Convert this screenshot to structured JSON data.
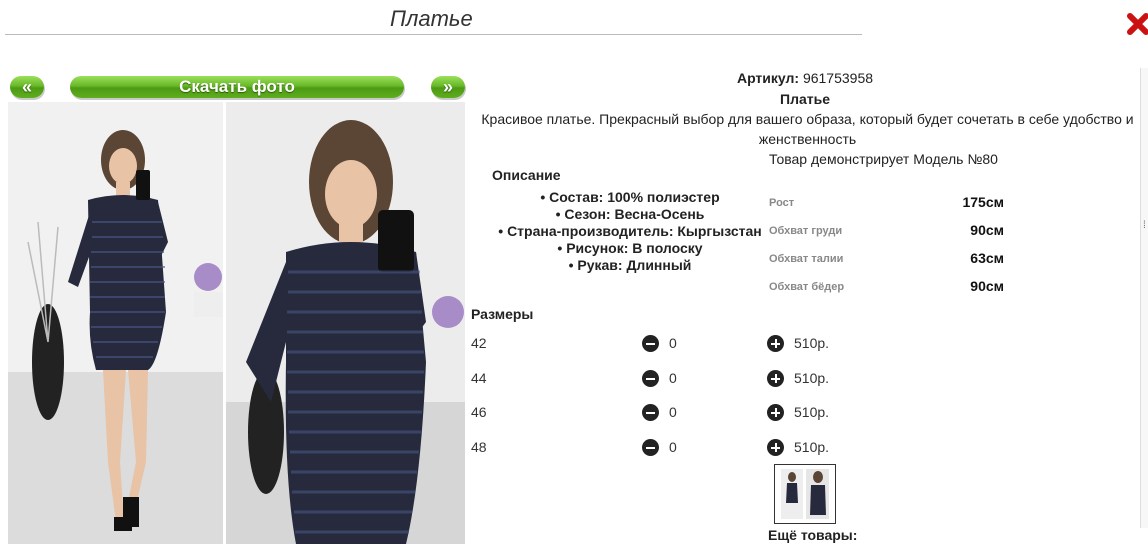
{
  "header": {
    "title": "Платье"
  },
  "gallery": {
    "prev_label": "«",
    "download_label": "Скачать фото",
    "next_label": "»"
  },
  "product": {
    "article_label": "Артикул:",
    "article_value": "961753958",
    "name": "Платье",
    "description": "Красивое платье. Прекрасный выбор для вашего образа, который будет сочетать в себе удобство и женственность",
    "model_text": "Товар демонстрирует Модель №80",
    "description_heading": "Описание",
    "specs": [
      "Состав: 100% полиэстер",
      "Сезон: Весна-Осень",
      "Страна-производитель: Кыргызстан",
      "Рисунок: В полоску",
      "Рукав: Длинный"
    ],
    "measurements": [
      {
        "label": "Рост",
        "value": "175см"
      },
      {
        "label": "Обхват груди",
        "value": "90см"
      },
      {
        "label": "Обхват талии",
        "value": "63см"
      },
      {
        "label": "Обхват бёдер",
        "value": "90см"
      }
    ]
  },
  "sizes": {
    "heading": "Размеры",
    "rows": [
      {
        "size": "42",
        "qty": "0",
        "price": "510р."
      },
      {
        "size": "44",
        "qty": "0",
        "price": "510р."
      },
      {
        "size": "46",
        "qty": "0",
        "price": "510р."
      },
      {
        "size": "48",
        "qty": "0",
        "price": "510р."
      }
    ]
  },
  "more_products_label": "Ещё товары:",
  "colors": {
    "accent_green": "#5fae1f",
    "close_red": "#cc1111",
    "dress": "#262a3c"
  }
}
